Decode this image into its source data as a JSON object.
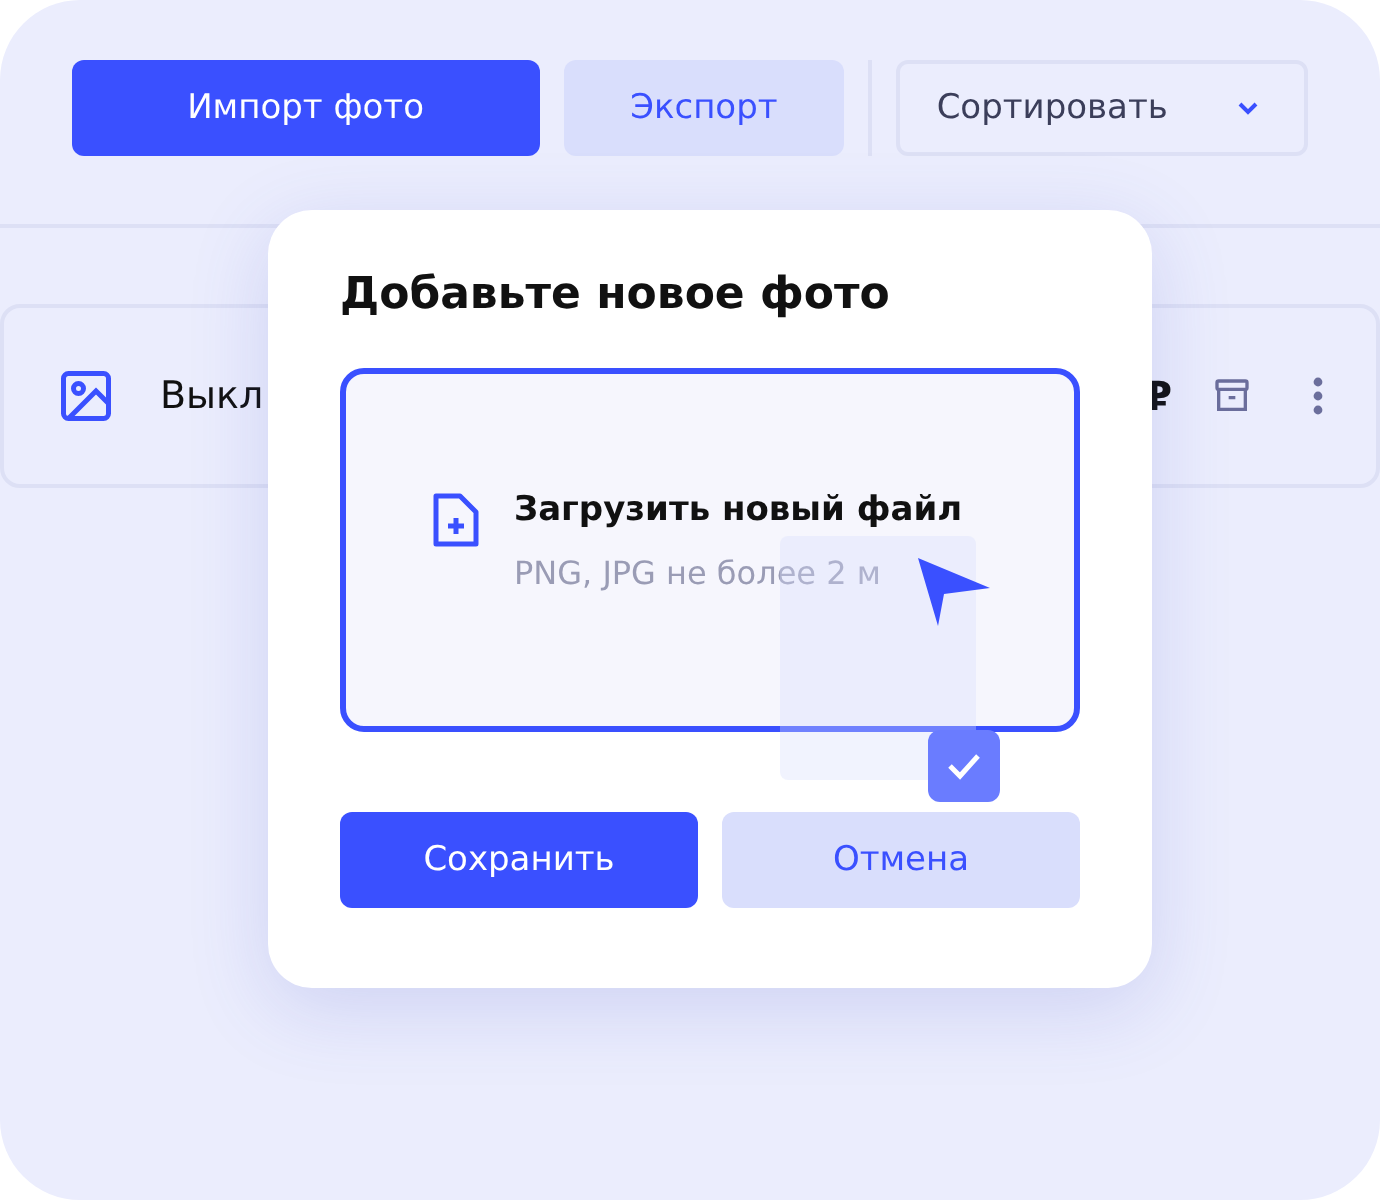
{
  "toolbar": {
    "import_button": "Импорт фото",
    "export_button": "Экспорт",
    "sort_dropdown": "Сортировать"
  },
  "row": {
    "name": "Выкл",
    "price_symbol": "₽"
  },
  "dialog": {
    "title": "Добавьте новое фото",
    "upload": {
      "label": "Загрузить новый файл",
      "hint": "PNG, JPG не более 2 м"
    },
    "buttons": [
      {
        "label": "Сохранить",
        "kind": "primary"
      },
      {
        "label": "Отмена",
        "kind": "secondary"
      }
    ]
  },
  "dragged_file": {
    "checked": true
  }
}
